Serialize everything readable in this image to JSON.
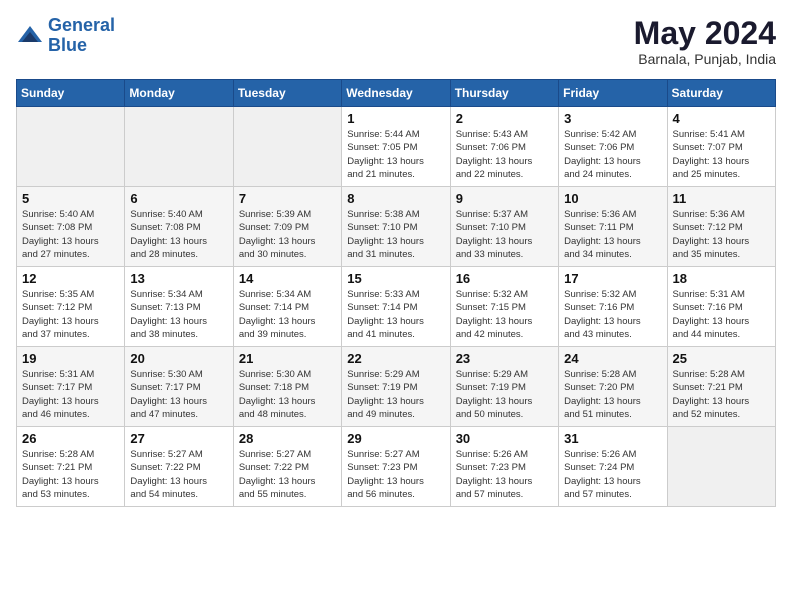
{
  "header": {
    "logo_line1": "General",
    "logo_line2": "Blue",
    "month_year": "May 2024",
    "location": "Barnala, Punjab, India"
  },
  "weekdays": [
    "Sunday",
    "Monday",
    "Tuesday",
    "Wednesday",
    "Thursday",
    "Friday",
    "Saturday"
  ],
  "weeks": [
    [
      {
        "day": "",
        "info": ""
      },
      {
        "day": "",
        "info": ""
      },
      {
        "day": "",
        "info": ""
      },
      {
        "day": "1",
        "info": "Sunrise: 5:44 AM\nSunset: 7:05 PM\nDaylight: 13 hours\nand 21 minutes."
      },
      {
        "day": "2",
        "info": "Sunrise: 5:43 AM\nSunset: 7:06 PM\nDaylight: 13 hours\nand 22 minutes."
      },
      {
        "day": "3",
        "info": "Sunrise: 5:42 AM\nSunset: 7:06 PM\nDaylight: 13 hours\nand 24 minutes."
      },
      {
        "day": "4",
        "info": "Sunrise: 5:41 AM\nSunset: 7:07 PM\nDaylight: 13 hours\nand 25 minutes."
      }
    ],
    [
      {
        "day": "5",
        "info": "Sunrise: 5:40 AM\nSunset: 7:08 PM\nDaylight: 13 hours\nand 27 minutes."
      },
      {
        "day": "6",
        "info": "Sunrise: 5:40 AM\nSunset: 7:08 PM\nDaylight: 13 hours\nand 28 minutes."
      },
      {
        "day": "7",
        "info": "Sunrise: 5:39 AM\nSunset: 7:09 PM\nDaylight: 13 hours\nand 30 minutes."
      },
      {
        "day": "8",
        "info": "Sunrise: 5:38 AM\nSunset: 7:10 PM\nDaylight: 13 hours\nand 31 minutes."
      },
      {
        "day": "9",
        "info": "Sunrise: 5:37 AM\nSunset: 7:10 PM\nDaylight: 13 hours\nand 33 minutes."
      },
      {
        "day": "10",
        "info": "Sunrise: 5:36 AM\nSunset: 7:11 PM\nDaylight: 13 hours\nand 34 minutes."
      },
      {
        "day": "11",
        "info": "Sunrise: 5:36 AM\nSunset: 7:12 PM\nDaylight: 13 hours\nand 35 minutes."
      }
    ],
    [
      {
        "day": "12",
        "info": "Sunrise: 5:35 AM\nSunset: 7:12 PM\nDaylight: 13 hours\nand 37 minutes."
      },
      {
        "day": "13",
        "info": "Sunrise: 5:34 AM\nSunset: 7:13 PM\nDaylight: 13 hours\nand 38 minutes."
      },
      {
        "day": "14",
        "info": "Sunrise: 5:34 AM\nSunset: 7:14 PM\nDaylight: 13 hours\nand 39 minutes."
      },
      {
        "day": "15",
        "info": "Sunrise: 5:33 AM\nSunset: 7:14 PM\nDaylight: 13 hours\nand 41 minutes."
      },
      {
        "day": "16",
        "info": "Sunrise: 5:32 AM\nSunset: 7:15 PM\nDaylight: 13 hours\nand 42 minutes."
      },
      {
        "day": "17",
        "info": "Sunrise: 5:32 AM\nSunset: 7:16 PM\nDaylight: 13 hours\nand 43 minutes."
      },
      {
        "day": "18",
        "info": "Sunrise: 5:31 AM\nSunset: 7:16 PM\nDaylight: 13 hours\nand 44 minutes."
      }
    ],
    [
      {
        "day": "19",
        "info": "Sunrise: 5:31 AM\nSunset: 7:17 PM\nDaylight: 13 hours\nand 46 minutes."
      },
      {
        "day": "20",
        "info": "Sunrise: 5:30 AM\nSunset: 7:17 PM\nDaylight: 13 hours\nand 47 minutes."
      },
      {
        "day": "21",
        "info": "Sunrise: 5:30 AM\nSunset: 7:18 PM\nDaylight: 13 hours\nand 48 minutes."
      },
      {
        "day": "22",
        "info": "Sunrise: 5:29 AM\nSunset: 7:19 PM\nDaylight: 13 hours\nand 49 minutes."
      },
      {
        "day": "23",
        "info": "Sunrise: 5:29 AM\nSunset: 7:19 PM\nDaylight: 13 hours\nand 50 minutes."
      },
      {
        "day": "24",
        "info": "Sunrise: 5:28 AM\nSunset: 7:20 PM\nDaylight: 13 hours\nand 51 minutes."
      },
      {
        "day": "25",
        "info": "Sunrise: 5:28 AM\nSunset: 7:21 PM\nDaylight: 13 hours\nand 52 minutes."
      }
    ],
    [
      {
        "day": "26",
        "info": "Sunrise: 5:28 AM\nSunset: 7:21 PM\nDaylight: 13 hours\nand 53 minutes."
      },
      {
        "day": "27",
        "info": "Sunrise: 5:27 AM\nSunset: 7:22 PM\nDaylight: 13 hours\nand 54 minutes."
      },
      {
        "day": "28",
        "info": "Sunrise: 5:27 AM\nSunset: 7:22 PM\nDaylight: 13 hours\nand 55 minutes."
      },
      {
        "day": "29",
        "info": "Sunrise: 5:27 AM\nSunset: 7:23 PM\nDaylight: 13 hours\nand 56 minutes."
      },
      {
        "day": "30",
        "info": "Sunrise: 5:26 AM\nSunset: 7:23 PM\nDaylight: 13 hours\nand 57 minutes."
      },
      {
        "day": "31",
        "info": "Sunrise: 5:26 AM\nSunset: 7:24 PM\nDaylight: 13 hours\nand 57 minutes."
      },
      {
        "day": "",
        "info": ""
      }
    ]
  ]
}
